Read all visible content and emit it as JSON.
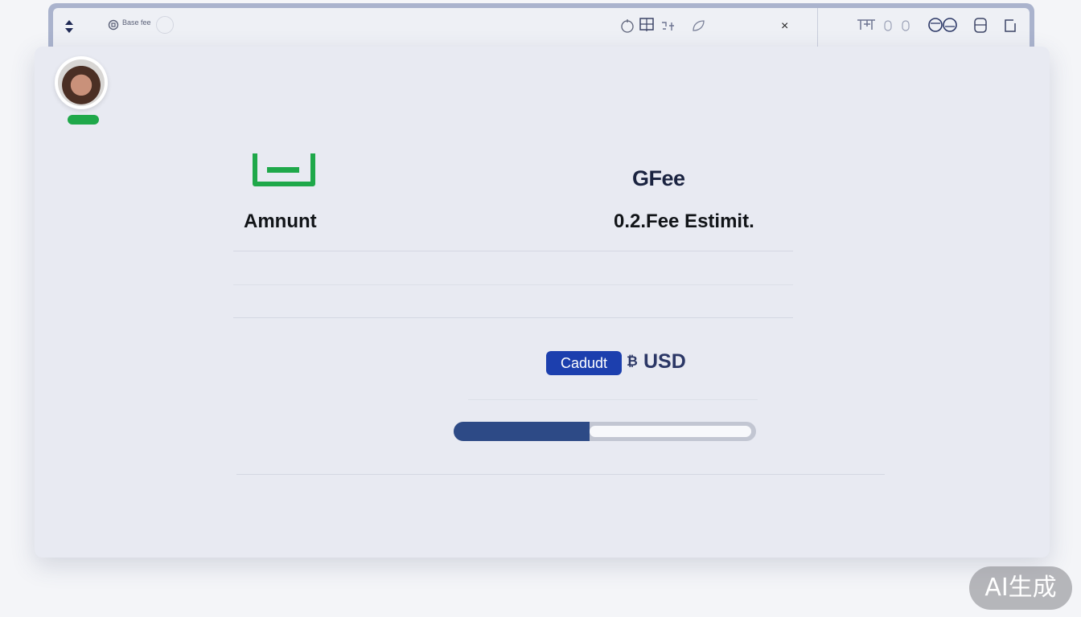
{
  "header": {
    "title_text": "Base fee",
    "close_glyph": "×",
    "icons": [
      "expand-icon",
      "logo-icon",
      "refresh-icon",
      "frame-icon",
      "network-icon",
      "leaf-icon",
      "close-icon",
      "grid-icon",
      "toggle-icon",
      "globe-icon",
      "wallet-icon",
      "external-icon"
    ]
  },
  "main": {
    "logo_text": "GFee",
    "amount_label": "Amnunt",
    "fee_label": "0.2.Fee Estimit.",
    "currency_button_label": "Cadudt",
    "currency_glyph": "₿",
    "currency_label": "USD",
    "progress": 0.45
  },
  "watermark": "AI生成",
  "colors": {
    "accent": "#1c3fae",
    "progress": "#2d4a86",
    "status": "#1fa84a",
    "wallet_icon": "#1fa84a"
  }
}
